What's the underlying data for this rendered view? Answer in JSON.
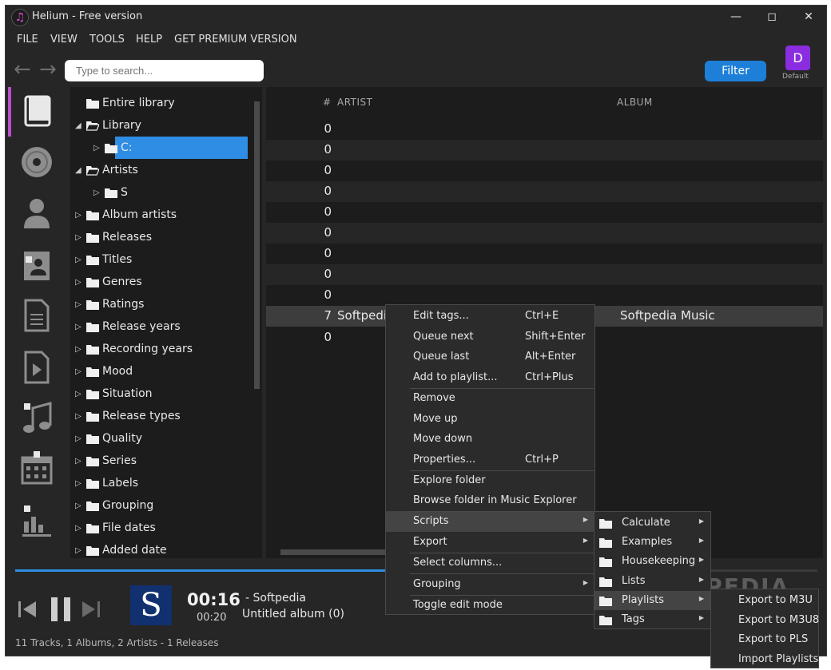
{
  "window": {
    "title": "Helium - Free version",
    "minimize": "—",
    "maximize": "◻",
    "close": "✕"
  },
  "menu": [
    "FILE",
    "VIEW",
    "TOOLS",
    "HELP",
    "GET PREMIUM VERSION"
  ],
  "toolbar": {
    "back": "←",
    "forward": "→",
    "search_placeholder": "Type to search...",
    "filter_label": "Filter",
    "profile_letter": "D",
    "profile_name": "Default"
  },
  "sidebar_icons": [
    "library-book-icon",
    "disc-icon",
    "person-icon",
    "contact-lock-icon",
    "document-icon",
    "video-play-icon",
    "music-note-lock-icon",
    "calendar-lock-icon",
    "chart-lock-icon"
  ],
  "tree": {
    "items": [
      {
        "label": "Entire library",
        "indent": 0,
        "expander": ""
      },
      {
        "label": "Library",
        "indent": 0,
        "expander": "◢"
      },
      {
        "label": "C:",
        "indent": 1,
        "expander": "▷",
        "selected": true
      },
      {
        "label": "Artists",
        "indent": 0,
        "expander": "◢"
      },
      {
        "label": "S",
        "indent": 1,
        "expander": "▷"
      },
      {
        "label": "Album artists",
        "indent": 0,
        "expander": "▷"
      },
      {
        "label": "Releases",
        "indent": 0,
        "expander": "▷"
      },
      {
        "label": "Titles",
        "indent": 0,
        "expander": "▷"
      },
      {
        "label": "Genres",
        "indent": 0,
        "expander": "▷"
      },
      {
        "label": "Ratings",
        "indent": 0,
        "expander": "▷"
      },
      {
        "label": "Release years",
        "indent": 0,
        "expander": "▷"
      },
      {
        "label": "Recording years",
        "indent": 0,
        "expander": "▷"
      },
      {
        "label": "Mood",
        "indent": 0,
        "expander": "▷"
      },
      {
        "label": "Situation",
        "indent": 0,
        "expander": "▷"
      },
      {
        "label": "Release types",
        "indent": 0,
        "expander": "▷"
      },
      {
        "label": "Quality",
        "indent": 0,
        "expander": "▷"
      },
      {
        "label": "Series",
        "indent": 0,
        "expander": "▷"
      },
      {
        "label": "Labels",
        "indent": 0,
        "expander": "▷"
      },
      {
        "label": "Grouping",
        "indent": 0,
        "expander": "▷"
      },
      {
        "label": "File dates",
        "indent": 0,
        "expander": "▷"
      },
      {
        "label": "Added date",
        "indent": 0,
        "expander": "▷"
      }
    ]
  },
  "tracks": {
    "columns": {
      "num": "#",
      "artist": "ARTIST",
      "album": "ALBUM"
    },
    "rows": [
      {
        "num": "0",
        "artist": "",
        "album": ""
      },
      {
        "num": "0",
        "artist": "",
        "album": ""
      },
      {
        "num": "0",
        "artist": "",
        "album": ""
      },
      {
        "num": "0",
        "artist": "",
        "album": ""
      },
      {
        "num": "0",
        "artist": "",
        "album": ""
      },
      {
        "num": "0",
        "artist": "",
        "album": ""
      },
      {
        "num": "0",
        "artist": "",
        "album": ""
      },
      {
        "num": "0",
        "artist": "",
        "album": ""
      },
      {
        "num": "0",
        "artist": "",
        "album": ""
      },
      {
        "num": "7",
        "artist": "Softpedia",
        "album": "Softpedia Music",
        "selected": true
      },
      {
        "num": "0",
        "artist": "",
        "album": ""
      }
    ]
  },
  "player": {
    "progress": 0.47,
    "cover_letter": "S",
    "elapsed": "00:16",
    "duration": "00:20",
    "artist": "- Softpedia",
    "album": "Untitled album (0)"
  },
  "status": "11 Tracks, 1 Albums, 2 Artists - 1 Releases",
  "context_menu": {
    "items": [
      {
        "label": "Edit tags...",
        "shortcut": "Ctrl+E"
      },
      {
        "label": "Queue next",
        "shortcut": "Shift+Enter"
      },
      {
        "label": "Queue last",
        "shortcut": "Alt+Enter"
      },
      {
        "label": "Add to playlist...",
        "shortcut": "Ctrl+Plus"
      },
      {
        "label": "Remove",
        "shortcut": ""
      },
      {
        "label": "Move up",
        "shortcut": ""
      },
      {
        "label": "Move down",
        "shortcut": ""
      },
      {
        "label": "Properties...",
        "shortcut": "Ctrl+P"
      },
      {
        "label": "Explore folder",
        "shortcut": ""
      },
      {
        "label": "Browse folder in Music Explorer",
        "shortcut": ""
      },
      {
        "label": "Scripts",
        "shortcut": "",
        "submenu": true,
        "highlighted": true
      },
      {
        "label": "Export",
        "shortcut": "",
        "submenu": true
      },
      {
        "label": "Select columns...",
        "shortcut": ""
      },
      {
        "label": "Grouping",
        "shortcut": "",
        "submenu": true
      },
      {
        "label": "Toggle edit mode",
        "shortcut": ""
      }
    ]
  },
  "scripts_menu": {
    "items": [
      {
        "label": "Calculate"
      },
      {
        "label": "Examples"
      },
      {
        "label": "Housekeeping"
      },
      {
        "label": "Lists"
      },
      {
        "label": "Playlists",
        "highlighted": true
      },
      {
        "label": "Tags"
      }
    ]
  },
  "playlists_menu": {
    "items": [
      "Export to M3U",
      "Export to M3U8",
      "Export to PLS",
      "Import Playlists"
    ]
  },
  "watermark": "SOFTPEDIA",
  "colors": {
    "accent": "#2f8de4",
    "active_tab": "#c24bd3",
    "profile": "#8a2de0",
    "filter": "#1e7fd8"
  }
}
